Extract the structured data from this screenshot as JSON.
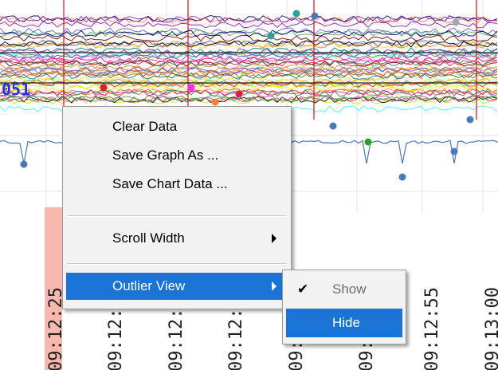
{
  "chart": {
    "left_label": "051",
    "x_ticks": [
      "09:12:25",
      "09:12:30",
      "09:12:35",
      "09:12:40",
      "09:12:45",
      "09:12:50",
      "09:12:55",
      "09:13:00"
    ],
    "highlight_color": "#f7b9ae"
  },
  "context_menu": {
    "items": [
      {
        "label": "Clear Data"
      },
      {
        "label": "Save Graph As ..."
      },
      {
        "label": "Save Chart Data ..."
      },
      {
        "label": "Scroll Width",
        "submenu": true
      },
      {
        "label": "Outlier View",
        "submenu": true,
        "active": true
      }
    ]
  },
  "submenu": {
    "items": [
      {
        "label": "Show",
        "checked": true,
        "disabled": true
      },
      {
        "label": "Hide",
        "active": true
      }
    ]
  },
  "colors": {
    "menu_highlight": "#1a74d6",
    "menu_background": "#f2f2f2"
  }
}
